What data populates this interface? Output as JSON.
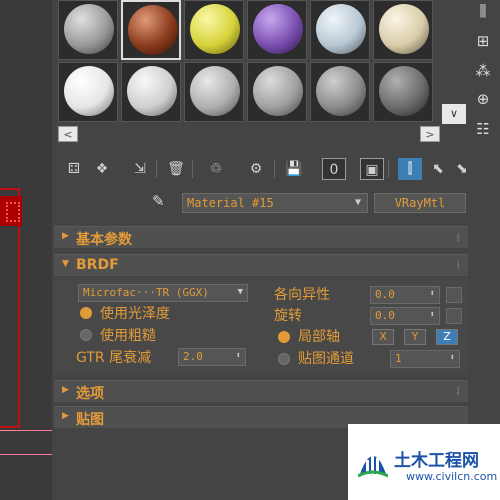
{
  "material_editor": {
    "swatches": [
      {
        "color": "#9a9a9a",
        "label": "slot-1"
      },
      {
        "color": "#8a3a1c",
        "label": "slot-2"
      },
      {
        "color": "#d6d33a",
        "label": "slot-3"
      },
      {
        "color": "#7a4fb0",
        "label": "slot-4"
      },
      {
        "color": "#b8c8d4",
        "label": "slot-5"
      },
      {
        "color": "#d9ccaa",
        "label": "slot-6"
      },
      {
        "color": "#e6e6e6",
        "label": "slot-7"
      },
      {
        "color": "#cfcfcf",
        "label": "slot-8"
      },
      {
        "color": "#b0b0b0",
        "label": "slot-9"
      },
      {
        "color": "#a0a0a0",
        "label": "slot-10"
      },
      {
        "color": "#8c8c8c",
        "label": "slot-11"
      },
      {
        "color": "#6c6c6c",
        "label": "slot-12"
      }
    ],
    "nav": {
      "prev": "<",
      "next": ">",
      "scroll": "∨"
    },
    "toolbar_zero_label": "0",
    "material_name": "Material #15",
    "material_type": "VRayMtl",
    "rollouts": {
      "basic": "基本参数",
      "brdf": "BRDF",
      "options": "选项",
      "maps": "贴图"
    },
    "brdf": {
      "type_value": "Microfac···TR (GGX)",
      "use_glossiness": "使用光泽度",
      "use_roughness": "使用粗糙",
      "gtr_tail_label": "GTR 尾衰减",
      "gtr_tail_value": "2.0",
      "anisotropy_label": "各向异性",
      "anisotropy_value": "0.0",
      "rotation_label": "旋转",
      "rotation_value": "0.0",
      "local_axis_label": "局部轴",
      "axis_x": "X",
      "axis_y": "Y",
      "axis_z": "Z",
      "map_channel_label": "贴图通道",
      "map_channel_value": "1"
    }
  },
  "watermark": {
    "name": "土木工程网",
    "url": "www.civilcn.com"
  },
  "colors": {
    "accent": "#e29b38",
    "active_blue": "#3d7fb5"
  }
}
